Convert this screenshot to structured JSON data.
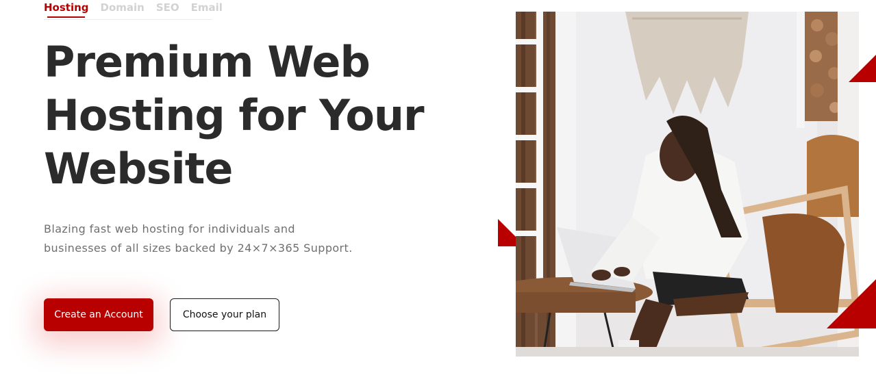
{
  "tabs": [
    {
      "label": "Hosting",
      "active": true
    },
    {
      "label": "Domain",
      "active": false
    },
    {
      "label": "SEO",
      "active": false
    },
    {
      "label": "Email",
      "active": false
    }
  ],
  "hero": {
    "title_line1": "Premium Web",
    "title_line2": "Hosting for Your",
    "title_line3": "Website",
    "description_line1": "Blazing fast web hosting for individuals and",
    "description_line2": "businesses of all sizes backed by 24×7×365 Support."
  },
  "buttons": {
    "primary_label": "Create an Account",
    "secondary_label": "Choose your plan"
  },
  "colors": {
    "accent": "#b80000",
    "heading": "#2b2b2b",
    "body_text": "#6f6f6f",
    "inactive_tab": "#d2d2d2"
  },
  "image": {
    "subject": "woman-working-on-laptop-photo"
  }
}
